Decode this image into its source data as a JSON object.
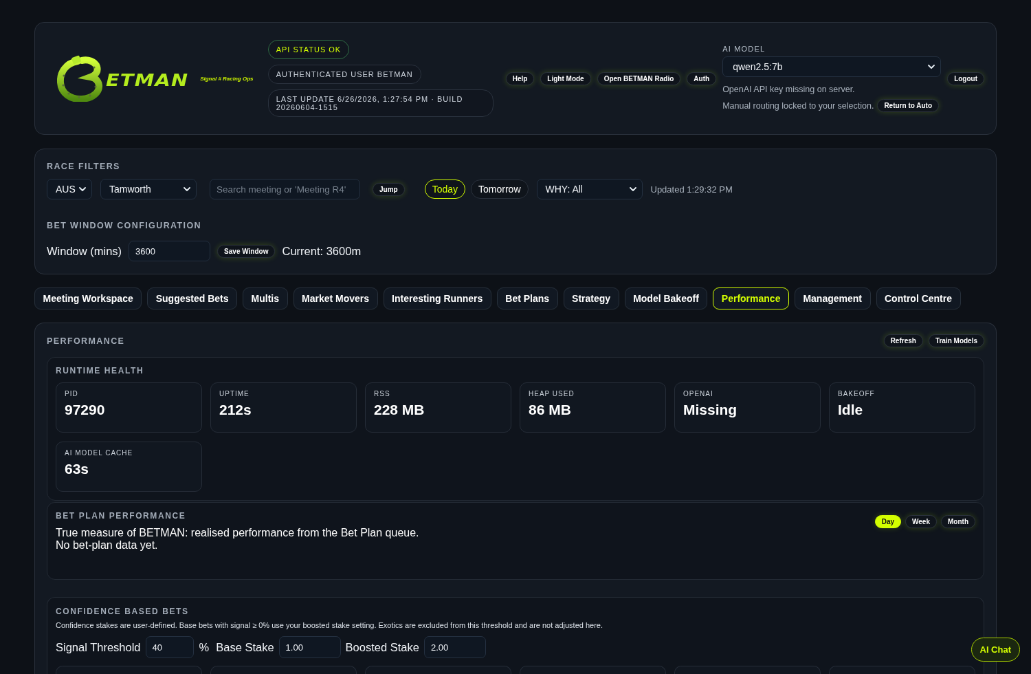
{
  "header": {
    "logo_text": "ETMAN",
    "tagline": "Signal # Racing Ops",
    "status_pills": [
      {
        "text": "API STATUS OK",
        "kind": "ok"
      },
      {
        "text": "AUTHENTICATED USER BETMAN",
        "kind": "info"
      },
      {
        "text": "LAST UPDATE 6/26/2026, 1:27:54 PM · BUILD 20260604-1515",
        "kind": "info"
      }
    ],
    "buttons": [
      "Help",
      "Light Mode",
      "Open BETMAN Radio",
      "Auth"
    ],
    "ai_model": {
      "label": "AI MODEL",
      "value": "qwen2.5:7b",
      "notice": "OpenAI API key missing on server.",
      "routing_note": "Manual routing locked to your selection.",
      "routing_button": "Return to Auto"
    },
    "logout_button": "Logout"
  },
  "race_filters": {
    "title": "RACE FILTERS",
    "country": "AUS",
    "meeting": "Tamworth",
    "search": {
      "placeholder": "Search meeting or 'Meeting R4'"
    },
    "jump_button": "Jump",
    "days": [
      {
        "label": "Today",
        "selected": true
      },
      {
        "label": "Tomorrow",
        "selected": false
      }
    ],
    "why_filter": "WHY: All",
    "updated": "Updated 1:29:32 PM"
  },
  "bet_window": {
    "title": "BET WINDOW CONFIGURATION",
    "label": "Window (mins)",
    "value": "3600",
    "save_button": "Save Window",
    "current": "Current: 3600m"
  },
  "tabs": [
    {
      "label": "Meeting Workspace",
      "selected": false
    },
    {
      "label": "Suggested Bets",
      "selected": false
    },
    {
      "label": "Multis",
      "selected": false
    },
    {
      "label": "Market Movers",
      "selected": false
    },
    {
      "label": "Interesting Runners",
      "selected": false
    },
    {
      "label": "Bet Plans",
      "selected": false
    },
    {
      "label": "Strategy",
      "selected": false
    },
    {
      "label": "Model Bakeoff",
      "selected": false
    },
    {
      "label": "Performance",
      "selected": true
    },
    {
      "label": "Management",
      "selected": false
    },
    {
      "label": "Control Centre",
      "selected": false
    }
  ],
  "performance": {
    "title": "PERFORMANCE",
    "buttons": [
      "Refresh",
      "Train Models"
    ],
    "runtime_health": {
      "title": "RUNTIME HEALTH",
      "metrics": [
        {
          "label": "PID",
          "value": "97290"
        },
        {
          "label": "UPTIME",
          "value": "212s"
        },
        {
          "label": "RSS",
          "value": "228 MB"
        },
        {
          "label": "HEAP USED",
          "value": "86 MB"
        },
        {
          "label": "OPENAI",
          "value": "Missing"
        },
        {
          "label": "BAKEOFF",
          "value": "Idle"
        },
        {
          "label": "AI MODEL CACHE",
          "value": "63s"
        }
      ]
    },
    "bet_plan": {
      "title": "BET PLAN PERFORMANCE",
      "lines": [
        "True measure of BETMAN: realised performance from the Bet Plan queue.",
        "No bet-plan data yet."
      ],
      "periods": [
        {
          "label": "Day",
          "selected": true
        },
        {
          "label": "Week",
          "selected": false
        },
        {
          "label": "Month",
          "selected": false
        }
      ]
    },
    "confidence": {
      "title": "CONFIDENCE BASED BETS",
      "description": "Confidence stakes are user-defined. Base bets with signal ≥ 0% use your boosted stake setting. Exotics are excluded from this threshold and are not adjusted here.",
      "fields": [
        {
          "label": "Signal Threshold",
          "value": "40",
          "unit": "%"
        },
        {
          "label": "Base Stake",
          "value": "1.00"
        },
        {
          "label": "Boosted Stake",
          "value": "2.00"
        }
      ]
    }
  },
  "ai_chat_button": "AI Chat"
}
